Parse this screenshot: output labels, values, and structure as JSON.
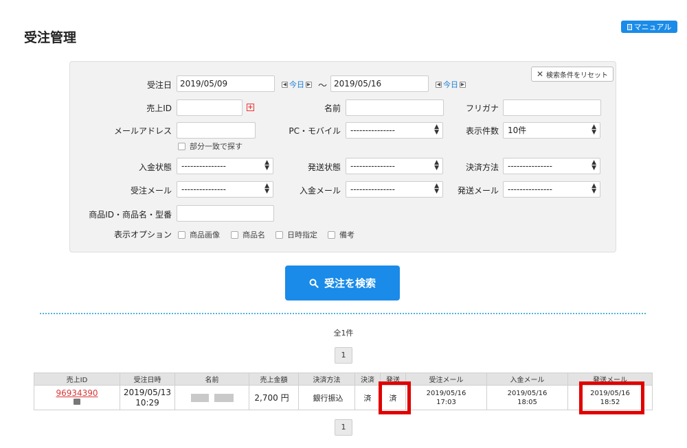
{
  "header": {
    "title": "受注管理",
    "manual_label": "マニュアル"
  },
  "search": {
    "reset_label": "検索条件をリセット",
    "order_date_label": "受注日",
    "date_from": "2019/05/09",
    "date_to": "2019/05/16",
    "today_label": "今日",
    "tilde": "〜",
    "sales_id_label": "売上ID",
    "sales_id_value": "",
    "name_label": "名前",
    "name_value": "",
    "furigana_label": "フリガナ",
    "furigana_value": "",
    "email_label": "メールアドレス",
    "email_value": "",
    "partial_match_label": "部分一致で探す",
    "device_label": "PC・モバイル",
    "device_value": "---------------",
    "display_count_label": "表示件数",
    "display_count_value": "10件",
    "payment_status_label": "入金状態",
    "payment_status_value": "---------------",
    "shipping_status_label": "発送状態",
    "shipping_status_value": "---------------",
    "payment_method_label": "決済方法",
    "payment_method_value": "---------------",
    "order_mail_label": "受注メール",
    "order_mail_value": "---------------",
    "payment_mail_label": "入金メール",
    "payment_mail_value": "---------------",
    "shipping_mail_label": "発送メール",
    "shipping_mail_value": "---------------",
    "product_label": "商品ID・商品名・型番",
    "product_value": "",
    "display_option_label": "表示オプション",
    "options": [
      "商品画像",
      "商品名",
      "日時指定",
      "備考"
    ],
    "submit_label": "受注を検索"
  },
  "results": {
    "count_text": "全1件",
    "page": "1",
    "columns": [
      "売上ID",
      "受注日時",
      "名前",
      "売上金額",
      "決済方法",
      "決済",
      "発送",
      "受注メール",
      "入金メール",
      "発送メール"
    ],
    "row": {
      "sales_id": "96934390",
      "order_date": "2019/05/13",
      "order_time": "10:29",
      "amount": "2,700 円",
      "payment_method": "銀行振込",
      "payment_done": "済",
      "shipping_done": "済",
      "order_mail_date": "2019/05/16",
      "order_mail_time": "17:03",
      "payment_mail_date": "2019/05/16",
      "payment_mail_time": "18:05",
      "shipping_mail_date": "2019/05/16",
      "shipping_mail_time": "18:52"
    }
  },
  "colors": {
    "accent": "#1a8be8",
    "link_red": "#d93636",
    "highlight": "#e00000"
  }
}
